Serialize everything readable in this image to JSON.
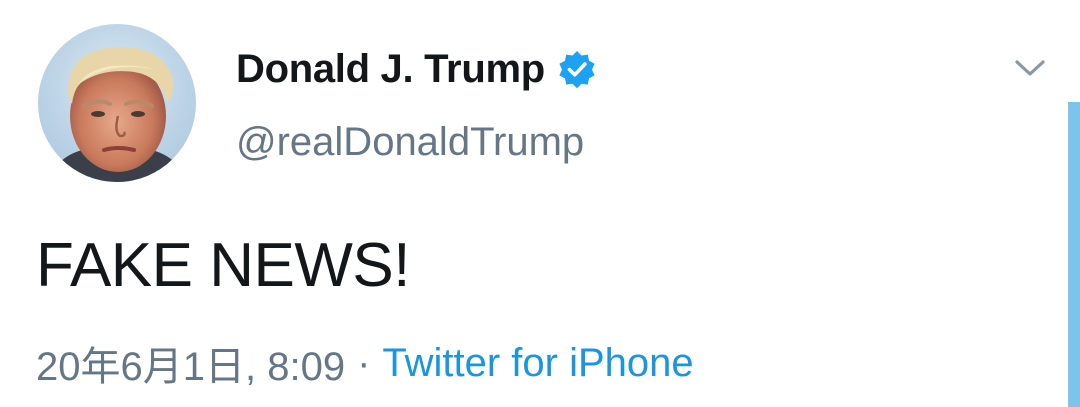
{
  "tweet": {
    "author": {
      "display_name": "Donald J. Trump",
      "handle": "@realDonaldTrump",
      "verified": true,
      "avatar_icon": "profile-photo"
    },
    "text": "FAKE NEWS!",
    "timestamp": "20年6月1日, 8:09",
    "separator": "·",
    "source": "Twitter for iPhone"
  },
  "icons": {
    "verified": "verified-badge-icon",
    "menu": "chevron-down-icon"
  },
  "colors": {
    "verified_blue": "#1da1f2",
    "link_blue": "#1b95e0",
    "secondary_text": "#657786",
    "primary_text": "#14171a",
    "scroll_indicator": "#7cc4ec"
  }
}
